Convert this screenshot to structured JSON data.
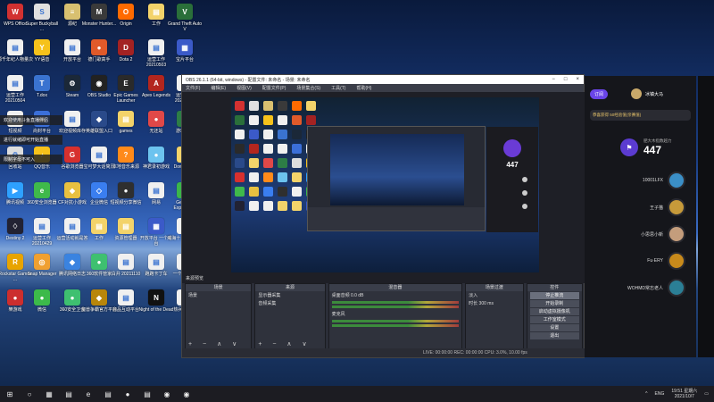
{
  "desktop_icons": [
    {
      "label": "WPS Office",
      "color": "#d23131",
      "glyph": "W"
    },
    {
      "label": "Super Buckyball ...",
      "color": "#e0e0e0",
      "glyph": "S"
    },
    {
      "label": "源纪",
      "color": "#d8c070",
      "glyph": "≡"
    },
    {
      "label": "Monster Hunter...",
      "color": "#3a3a3a",
      "glyph": "M"
    },
    {
      "label": "Origin",
      "color": "#ff6a00",
      "glyph": "O"
    },
    {
      "label": "工作",
      "color": "#f3d36a",
      "glyph": "▤"
    },
    {
      "label": "Grand Theft Auto V",
      "color": "#2a6f3a",
      "glyph": "V"
    },
    {
      "label": "源千年纪人物量次",
      "color": "#f0f0f0",
      "glyph": "▤"
    },
    {
      "label": "YY语音",
      "color": "#f6c21b",
      "glyph": "Y"
    },
    {
      "label": "开放平台",
      "color": "#f0f0f0",
      "glyph": "▤"
    },
    {
      "label": "德门歌高手",
      "color": "#e05a2a",
      "glyph": "●"
    },
    {
      "label": "Dota 2",
      "color": "#a32222",
      "glyph": "D"
    },
    {
      "label": "运营工作 20210503",
      "color": "#f0f0f0",
      "glyph": "▤"
    },
    {
      "label": "宝片平台",
      "color": "#3b5ac8",
      "glyph": "▦"
    },
    {
      "label": "运营工作 20210504",
      "color": "#f0f0f0",
      "glyph": "▤"
    },
    {
      "label": "T.dox",
      "color": "#3a73d0",
      "glyph": "T"
    },
    {
      "label": "Steam",
      "color": "#1b2838",
      "glyph": "⚙"
    },
    {
      "label": "OBS Studio",
      "color": "#222",
      "glyph": "◉"
    },
    {
      "label": "Epic Games Launcher",
      "color": "#2a2a2a",
      "glyph": "E"
    },
    {
      "label": "Apex Legends",
      "color": "#b3261e",
      "glyph": "A"
    },
    {
      "label": "运营工作 20210506",
      "color": "#f0f0f0",
      "glyph": "▤"
    },
    {
      "label": "短视频",
      "color": "#f0f0f0",
      "glyph": "▤"
    },
    {
      "label": "尚封平台",
      "color": "#3b6fd8",
      "glyph": "▦"
    },
    {
      "label": "欢迎视频库存",
      "color": "#f0f0f0",
      "glyph": "▤"
    },
    {
      "label": "英雄联盟入口",
      "color": "#2a4a8a",
      "glyph": "◆"
    },
    {
      "label": "games",
      "color": "#f3d36a",
      "glyph": "▤"
    },
    {
      "label": "无还站",
      "color": "#e04848",
      "glyph": "●"
    },
    {
      "label": "游戏服务",
      "color": "#2d7d46",
      "glyph": "●"
    },
    {
      "label": "回收站",
      "color": "#ddd",
      "glyph": "♲"
    },
    {
      "label": "QQ音乐",
      "color": "#f6c21b",
      "glyph": "♪"
    },
    {
      "label": "谷歌浏览器",
      "color": "#d7302e",
      "glyph": "G"
    },
    {
      "label": "宝可梦大话简历",
      "color": "#f0f0f0",
      "glyph": "▤"
    },
    {
      "label": "本地音乐来源",
      "color": "#ff8a1a",
      "glyph": "?"
    },
    {
      "label": "神君录初游戏",
      "color": "#6cc3ef",
      "glyph": "●"
    },
    {
      "label": "Downloads",
      "color": "#f3d36a",
      "glyph": "▤"
    },
    {
      "label": "腾讯视频",
      "color": "#2ea0ff",
      "glyph": "▶"
    },
    {
      "label": "360安全浏览器",
      "color": "#3fb94b",
      "glyph": "e"
    },
    {
      "label": "CF对抗小游戏",
      "color": "#e8c040",
      "glyph": "◆"
    },
    {
      "label": "企业微信",
      "color": "#3a7ef0",
      "glyph": "◇"
    },
    {
      "label": "短视频分享微信",
      "color": "#2f2f2f",
      "glyph": "●"
    },
    {
      "label": "网易",
      "color": "#f0f0f0",
      "glyph": "▤"
    },
    {
      "label": "GeForce Experience",
      "color": "#3bb54a",
      "glyph": "▲"
    },
    {
      "label": "Destiny 2",
      "color": "#223",
      "glyph": "♢"
    },
    {
      "label": "运营工作 20210429",
      "color": "#f0f0f0",
      "glyph": "▤"
    },
    {
      "label": "运营活动就是答",
      "color": "#f0f0f0",
      "glyph": "▤"
    },
    {
      "label": "工作",
      "color": "#f3d36a",
      "glyph": "▤"
    },
    {
      "label": "资源管理器",
      "color": "#f3d36a",
      "glyph": "▤"
    },
    {
      "label": "开放平台 一个平台",
      "color": "#3b5ac8",
      "glyph": "▦"
    },
    {
      "label": "威海十二级 4活动",
      "color": "#f0f0f0",
      "glyph": "▤"
    },
    {
      "label": "Rockstar Games ...",
      "color": "#e8a400",
      "glyph": "R"
    },
    {
      "label": "Snap Manager",
      "color": "#f0a030",
      "glyph": "◎"
    },
    {
      "label": "腾讯网络日志",
      "color": "#3a83e0",
      "glyph": "◆"
    },
    {
      "label": "360软件管家",
      "color": "#3ec070",
      "glyph": "●"
    },
    {
      "label": "白弁 20211110",
      "color": "#f0f0f0",
      "glyph": "▤"
    },
    {
      "label": "跑跑卡丁车",
      "color": "#f0f0f0",
      "glyph": "▤"
    },
    {
      "label": "一个游戏.rlz",
      "color": "#f0f0f0",
      "glyph": "▤"
    },
    {
      "label": "樂游戏",
      "color": "#cc2e2e",
      "glyph": "●"
    },
    {
      "label": "微信",
      "color": "#3cba4a",
      "glyph": "●"
    },
    {
      "label": "360安全卫士",
      "color": "#3ec070",
      "glyph": "●"
    },
    {
      "label": "魔兽争霸官方平台",
      "color": "#b8860b",
      "glyph": "◆"
    },
    {
      "label": "商品互动平台",
      "color": "#f0f0f0",
      "glyph": "▤"
    },
    {
      "label": "Night of the Dead",
      "color": "#111",
      "glyph": "N"
    },
    {
      "label": "热兵片传嗨",
      "color": "#f0f0f0",
      "glyph": "▤"
    }
  ],
  "toasts": {
    "line1": "欢迎使用斗鱼直播伴侣",
    "line2": "进行就绪即可开始直播",
    "line3": "限制字母不可入"
  },
  "obs": {
    "title": "OBS 26.1.1 (64-bit, windows) - 配置文件: 未命名 - 场景: 未命名",
    "menu": [
      "文件(F)",
      "编辑(E)",
      "视图(V)",
      "配置文件(P)",
      "场景集合(S)",
      "工具(T)",
      "帮助(H)"
    ],
    "source_label": "来源预览",
    "nested_score": "447",
    "docks": {
      "scenes": {
        "header": "场景",
        "rows": [
          "场景"
        ]
      },
      "sources": {
        "header": "来源",
        "rows": [
          "显示器采集",
          "音频采集"
        ]
      },
      "mixer": {
        "header": "混音器",
        "rows": [
          "桌面音频 0.0 dB",
          "麦克风"
        ]
      },
      "transitions": {
        "header": "场景过渡",
        "rows": [
          "淡入",
          "时长 300 ms"
        ]
      },
      "controls": {
        "header": "控件",
        "buttons": [
          "停止推流",
          "开始录制",
          "启动虚拟摄像机",
          "工作室模式",
          "设置",
          "退出"
        ]
      },
      "foot_icons": "+ − ∧ ∨"
    },
    "status": "LIVE: 00:00:00   REC: 00:00:00   CPU: 3.0%, 10.00 fps"
  },
  "panel": {
    "subscribe_label": "订阅",
    "streamer_name": "冰镇大马",
    "notice": "恭喜获得 50经验值(亲赛值)",
    "score_label": "肥大木指数越力",
    "score": "447",
    "fans": [
      {
        "name": "10001LFX",
        "color": "#3b8fc7"
      },
      {
        "name": "王子猫",
        "color": "#c69a3a"
      },
      {
        "name": "小思思小新",
        "color": "#c49d7c"
      },
      {
        "name": "Fu·ERY",
        "color": "#c88a1b"
      },
      {
        "name": "WOHMD常忘老人",
        "color": "#2b7f96"
      }
    ]
  },
  "taskbar": {
    "items": [
      "⊞",
      "○",
      "▦",
      "▤",
      "e",
      "▤",
      "●",
      "▤",
      "◉",
      "◉"
    ],
    "lang": "ENG",
    "time": "19:51 星期六",
    "date": "2021/10/7"
  }
}
